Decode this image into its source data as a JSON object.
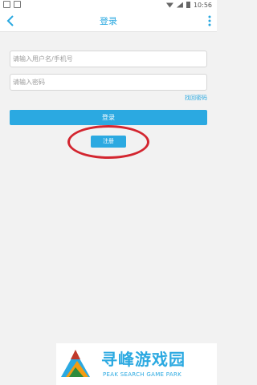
{
  "status_bar": {
    "time": "10:56"
  },
  "header": {
    "title": "登录"
  },
  "form": {
    "username_placeholder": "请输入用户名/手机号",
    "password_placeholder": "请输入密码",
    "forgot_label": "找回密码",
    "login_label": "登录",
    "register_label": "注册"
  },
  "watermark": {
    "title": "寻峰游戏园",
    "subtitle": "PEAK SEARCH GAME PARK"
  },
  "colors": {
    "accent": "#2ba9e1",
    "highlight_circle": "#d3252f"
  }
}
